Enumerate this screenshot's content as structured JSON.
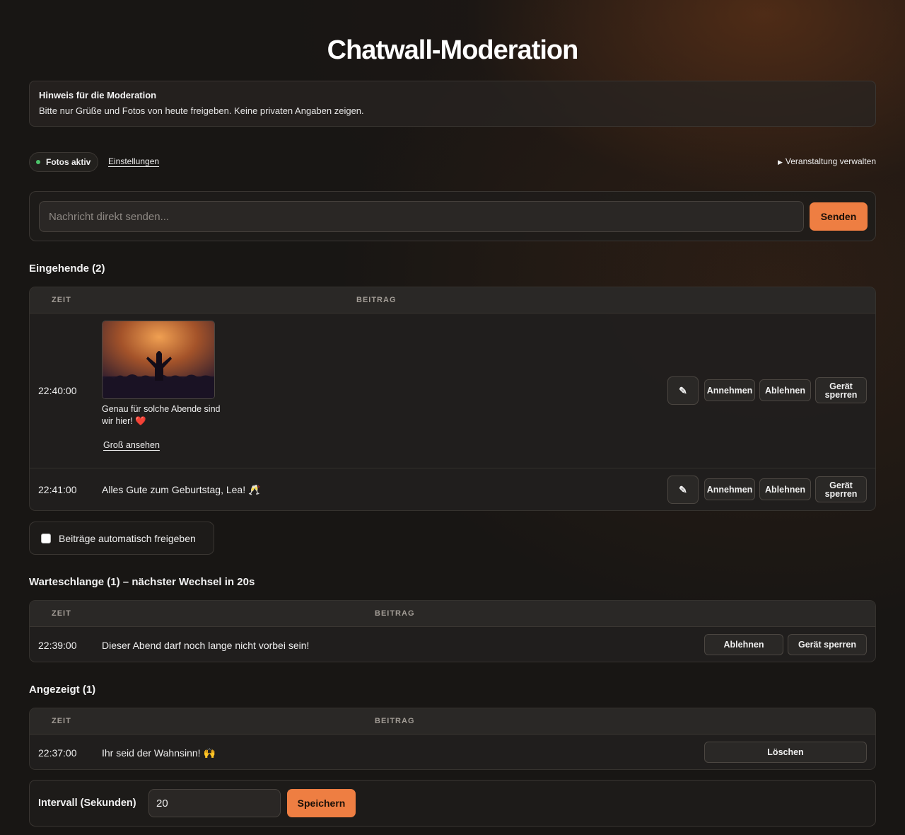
{
  "page": {
    "title": "Chatwall-Moderation"
  },
  "notice": {
    "title": "Hinweis für die Moderation",
    "text": "Bitte nur Grüße und Fotos von heute freigeben. Keine privaten Angaben zeigen."
  },
  "status": {
    "label": "Fotos aktiv",
    "settings_link": "Einstellungen",
    "event_toggle": "Veranstaltung verwalten"
  },
  "composer": {
    "placeholder": "Nachricht direkt senden...",
    "send_label": "Senden"
  },
  "columns": {
    "time": "ZEIT",
    "post": "BEITRAG"
  },
  "incoming": {
    "title": "Eingehende (2)",
    "rows": [
      {
        "time": "22:40:00",
        "caption": "Genau für solche Abende sind wir hier! ❤️",
        "link": "Groß ansehen"
      },
      {
        "time": "22:41:00",
        "text": "Alles Gute zum Geburtstag, Lea! 🥂"
      }
    ],
    "actions": {
      "edit": "✎",
      "accept": "Annehmen",
      "reject": "Ablehnen",
      "block": "Gerät sperren"
    }
  },
  "auto_approve": {
    "label": "Beiträge automatisch freigeben",
    "checked": false
  },
  "queue": {
    "title": "Warteschlange (1) – nächster Wechsel in 20s",
    "rows": [
      {
        "time": "22:39:00",
        "text": "Dieser Abend darf noch lange nicht vorbei sein!"
      }
    ],
    "actions": {
      "reject": "Ablehnen",
      "block": "Gerät sperren"
    }
  },
  "shown": {
    "title": "Angezeigt (1)",
    "rows": [
      {
        "time": "22:37:00",
        "text": "Ihr seid der Wahnsinn! 🙌"
      }
    ],
    "actions": {
      "delete": "Löschen"
    }
  },
  "interval": {
    "label": "Intervall (Sekunden)",
    "value": "20",
    "save_label": "Speichern"
  },
  "colors": {
    "accent": "#ee7e42",
    "status_dot": "#4cc46a",
    "background": "#181614"
  }
}
